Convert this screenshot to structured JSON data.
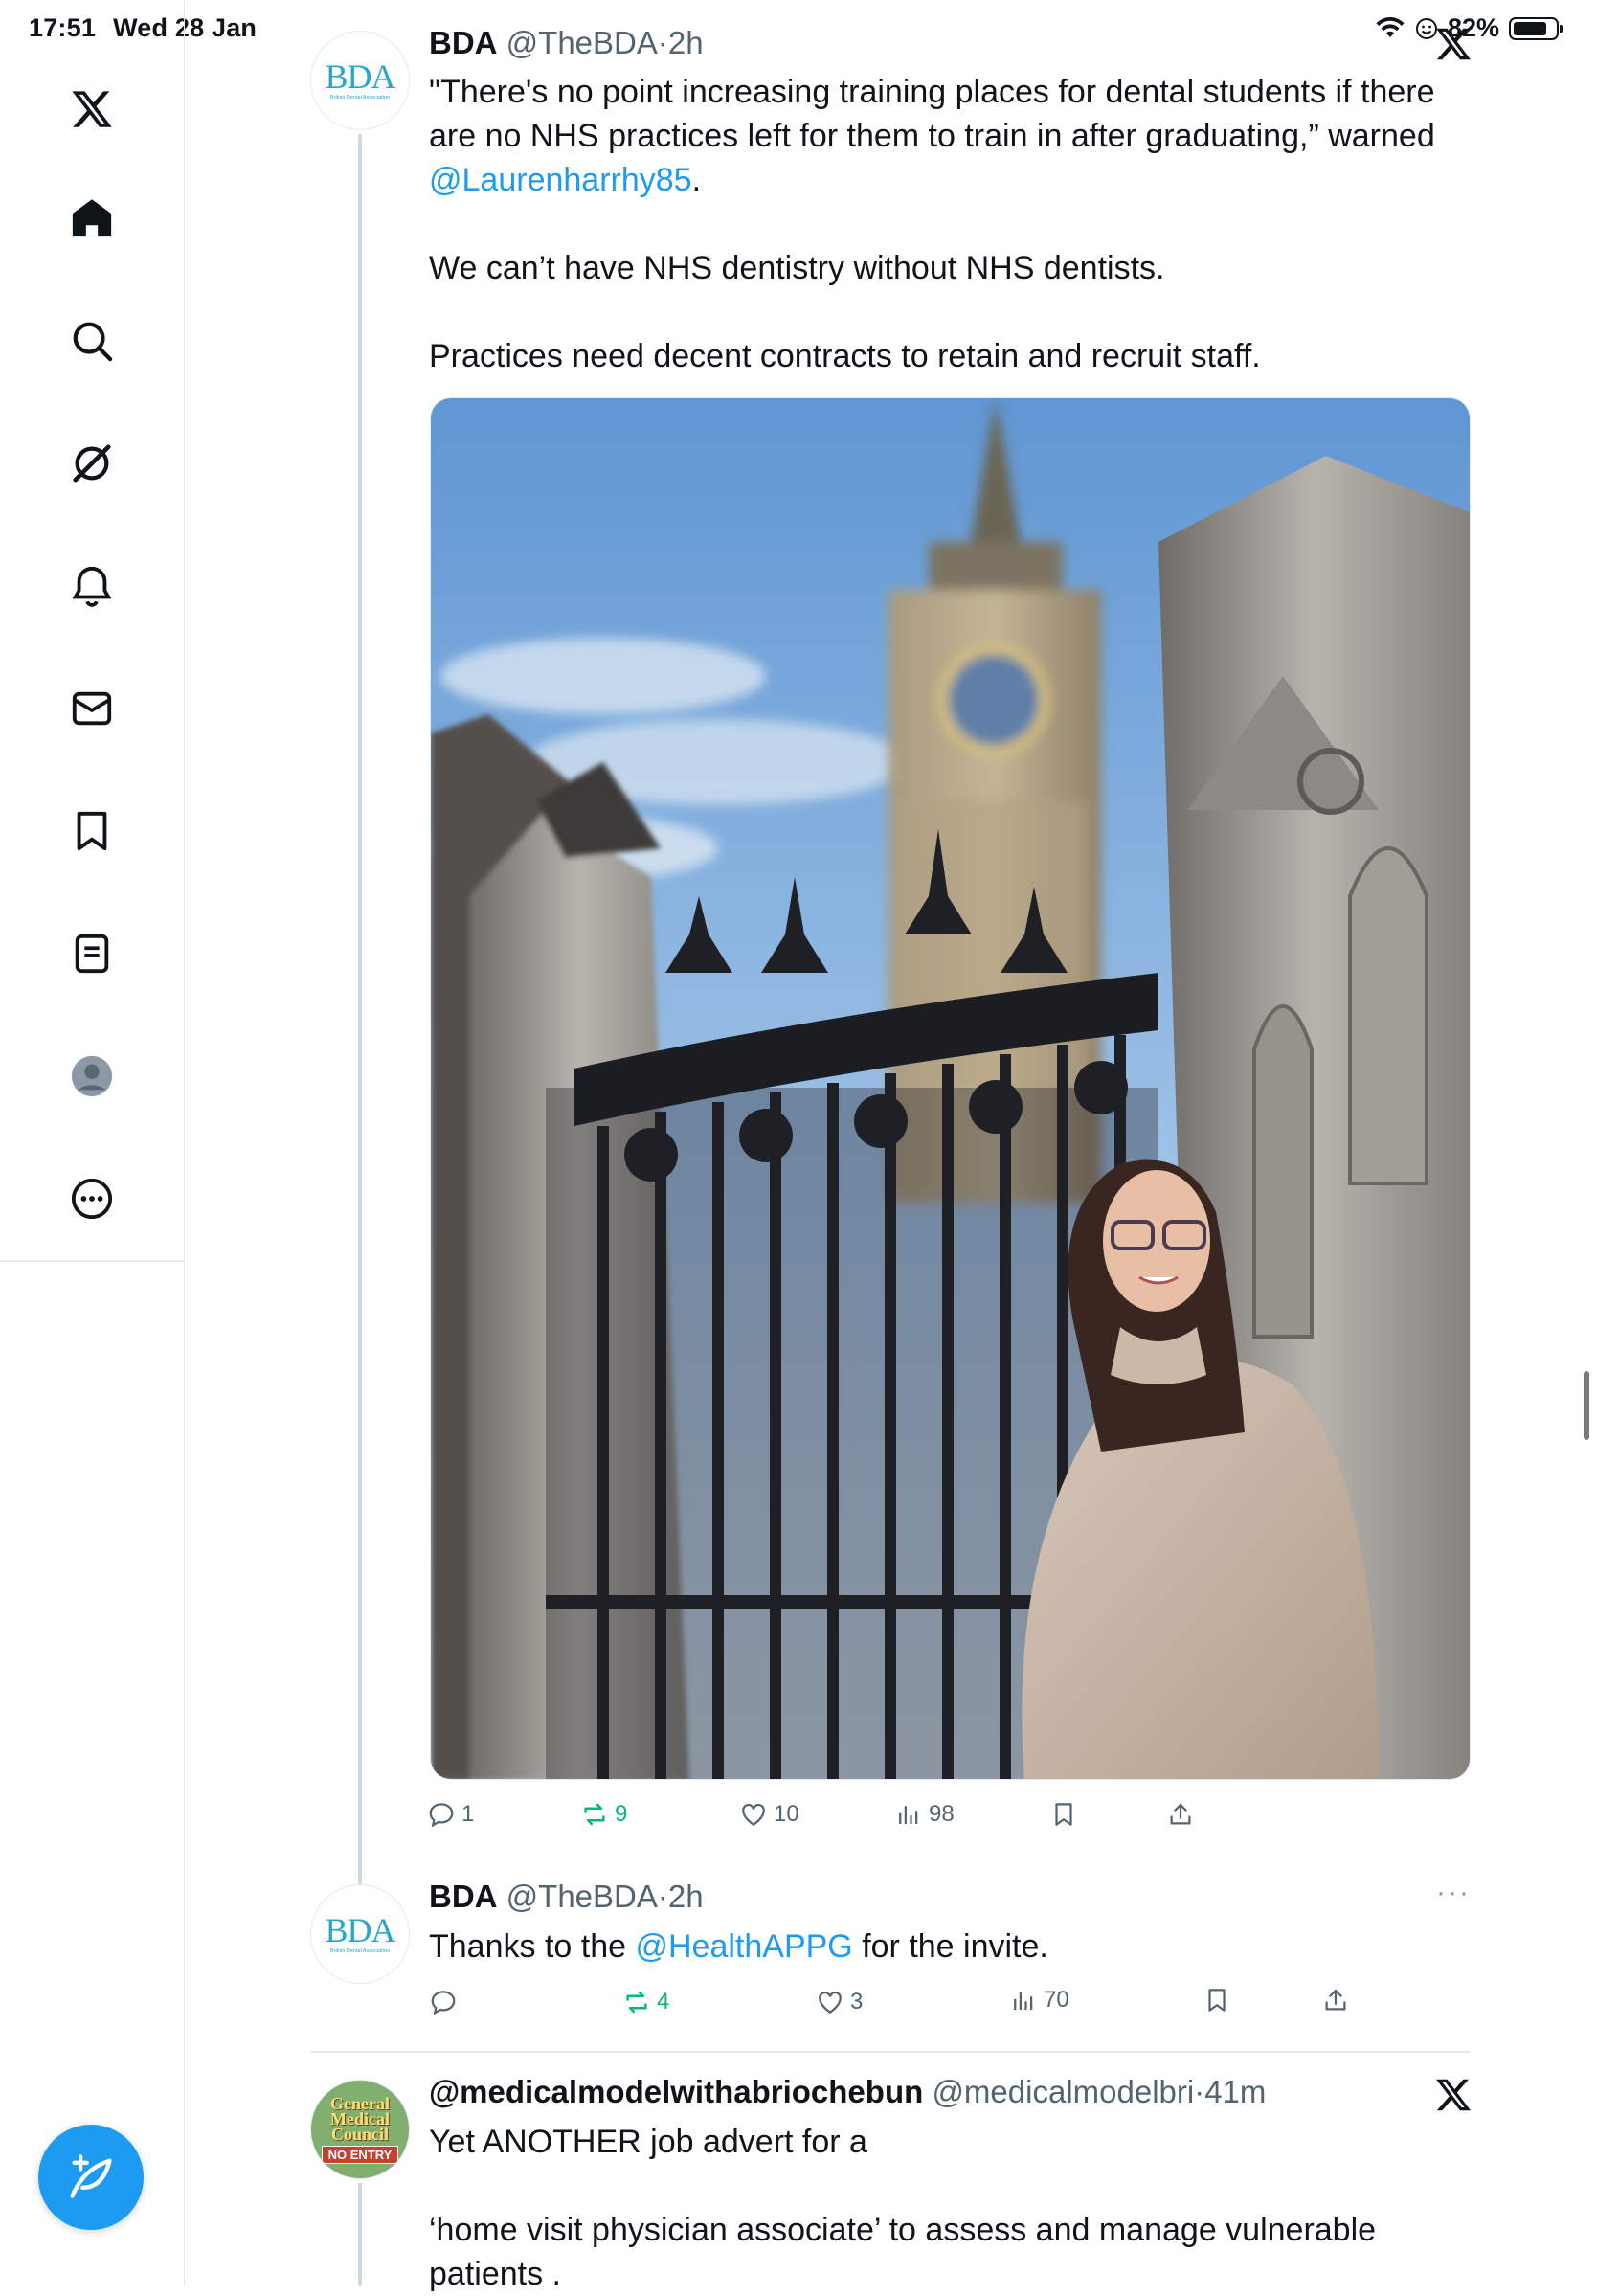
{
  "status_bar": {
    "time": "17:51",
    "date": "Wed 28 Jan",
    "battery": "82%",
    "battery_level": 0.82
  },
  "sidebar": {
    "items": [
      {
        "name": "x-logo-icon"
      },
      {
        "name": "home-icon"
      },
      {
        "name": "search-icon"
      },
      {
        "name": "grok-icon"
      },
      {
        "name": "notifications-icon"
      },
      {
        "name": "messages-icon"
      },
      {
        "name": "bookmarks-icon"
      },
      {
        "name": "lists-icon"
      },
      {
        "name": "profile-icon"
      },
      {
        "name": "more-icon"
      }
    ],
    "compose": {
      "icon": "compose-feather-icon"
    }
  },
  "tweets": [
    {
      "name": "BDA",
      "handle": "@TheBDA",
      "dot": "·",
      "time": "2h",
      "avatar_text": "BDA",
      "avatar_subtext": "British Dental Association",
      "text": {
        "line1": "\"There's no point increasing training places for dental students if there are no NHS practices left for them to train in after graduating,” warned ",
        "mention": "@Laurenharrhy85",
        "line1_end": ".",
        "line2": "We can’t have NHS dentistry without NHS dentists.",
        "line3": "Practices need decent contracts to retain and recruit staff."
      },
      "actions": {
        "replies": "1",
        "reposts": "9",
        "likes": "10",
        "views": "98"
      }
    },
    {
      "name": "BDA",
      "handle": "@TheBDA",
      "dot": "·",
      "time": "2h",
      "avatar_text": "BDA",
      "avatar_subtext": "British Dental Association",
      "text": {
        "before": "Thanks to the ",
        "mention": "@HealthAPPG",
        "after": " for the invite."
      },
      "actions": {
        "replies": "",
        "reposts": "4",
        "likes": "3",
        "views": "70"
      },
      "more": "···"
    },
    {
      "name": "@medicalmodelwithabriochebun",
      "handle": "@medicalmodelbri",
      "dot": "·",
      "time": "41m",
      "avatar_text": "General Medical Council",
      "avatar_stamp": "NO ENTRY",
      "text": {
        "line1": "Yet ANOTHER job advert for a",
        "line2": "‘home visit physician associate’ to assess and manage vulnerable patients ."
      }
    }
  ],
  "colors": {
    "accent": "#1d9bf0",
    "repost_green": "#00ba7c",
    "muted": "#536471"
  }
}
